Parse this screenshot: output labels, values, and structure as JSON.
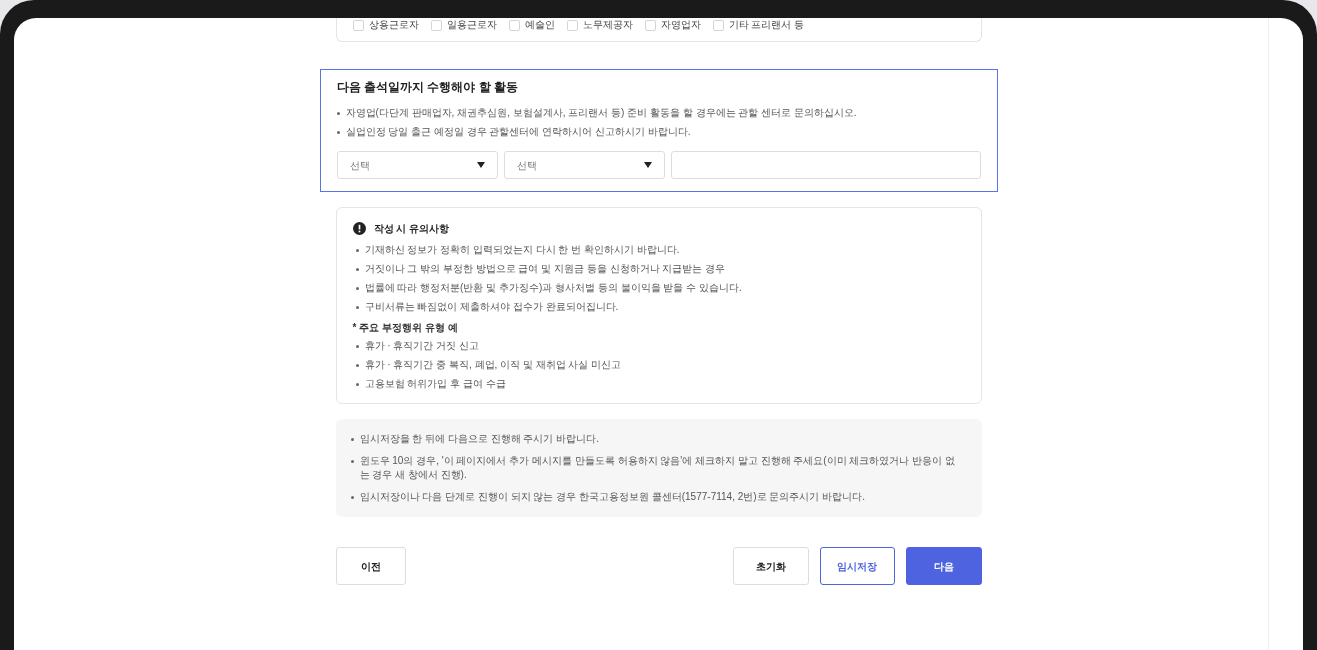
{
  "worker_types": [
    {
      "label": "상용근로자",
      "checked": false
    },
    {
      "label": "일용근로자",
      "checked": false
    },
    {
      "label": "예술인",
      "checked": false
    },
    {
      "label": "노무제공자",
      "checked": false
    },
    {
      "label": "자영업자",
      "checked": false
    },
    {
      "label": "기타 프리랜서 등",
      "checked": false
    }
  ],
  "activity": {
    "title": "다음 출석일까지 수행해야 할 활동",
    "notes": [
      "자영업(다단계  판매업자, 채권추심원, 보험설계사, 프리랜서 등) 준비 활동을 할 경우에는 관할 센터로 문의하십시오.",
      "실업인정 당일 출근 예정일 경우 관할센터에 연락하시어 신고하시기 바랍니다."
    ],
    "selects": [
      {
        "placeholder": "선택"
      },
      {
        "placeholder": "선택"
      }
    ]
  },
  "caution": {
    "title": "작성 시 유의사항",
    "items": [
      "기재하신 정보가 정확히 입력되었는지 다시 한 번 확인하시기 바랍니다.",
      "거짓이나 그 밖의 부정한 방법으로 급여 및 지원금 등을 신청하거나 지급받는 경우",
      "법률에 따라 행정처분(반환 및 추가징수)과 형사처벌 등의 불이익을 받을 수 있습니다.",
      "구비서류는 빠짐없이 제출하셔야 접수가 완료되어집니다."
    ],
    "subtitle": "* 주요 부정행위 유형 예",
    "examples": [
      "휴가 · 휴직기간 거짓 신고",
      "휴가 · 휴직기간 중 복직, 폐업, 이직 및 재취업 사실 미신고",
      "고용보험 허위가입 후 급여 수급"
    ]
  },
  "info": [
    "임시저장을 한 뒤에 다음으로 진행해 주시기 바랍니다.",
    "윈도우 10의 경우, '이 페이지에서 추가 메시지를 만들도록 허용하지 않음'에 체크하지 말고 진행해 주세요(이미 체크하였거나 반응이 없는 경우 새 창에서 진행).",
    "임시저장이나 다음 단계로 진행이 되지 않는 경우 한국고용정보원 콜센터(1577-7114, 2번)로 문의주시기 바랍니다."
  ],
  "buttons": [
    {
      "label": "이전",
      "kind": "plain"
    },
    {
      "label": "초기화",
      "kind": "plain"
    },
    {
      "label": "임시저장",
      "kind": "outline"
    },
    {
      "label": "다음",
      "kind": "primary"
    }
  ]
}
